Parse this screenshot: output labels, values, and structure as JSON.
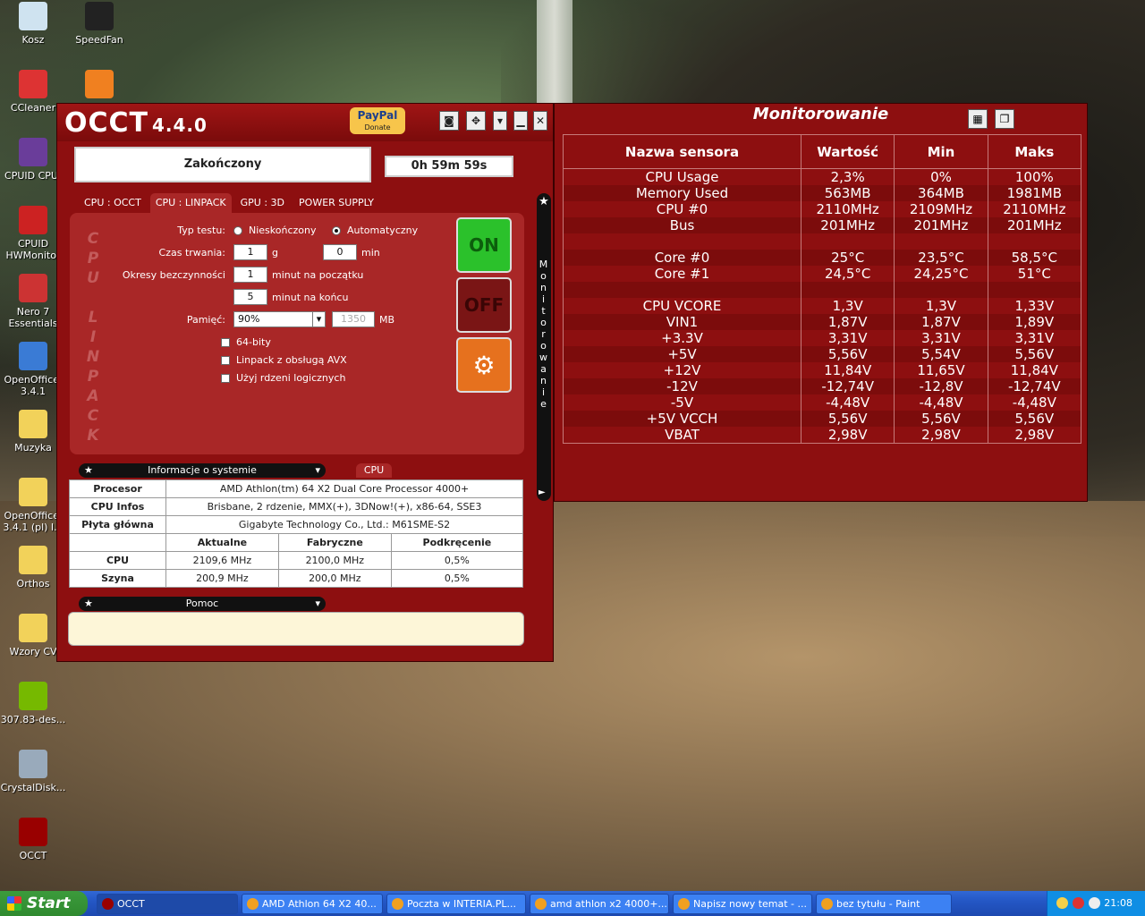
{
  "desktop": {
    "icons": [
      {
        "label": "Kosz",
        "icon": "recycle-bin-icon"
      },
      {
        "label": "SpeedFan",
        "icon": "fan-icon"
      },
      {
        "label": "CCleaner",
        "icon": "ccleaner-icon"
      },
      {
        "label": "",
        "icon": "avast-icon"
      },
      {
        "label": "CPUID CPU-",
        "icon": "cpuz-icon"
      },
      {
        "label": "CPUID HWMonitor",
        "icon": "hwmonitor-icon"
      },
      {
        "label": "Nero 7 Essentials",
        "icon": "nero-icon"
      },
      {
        "label": "OpenOffice. 3.4.1",
        "icon": "openoffice-icon"
      },
      {
        "label": "Muzyka",
        "icon": "folder-icon"
      },
      {
        "label": "OpenOffice. 3.4.1 (pl) I...",
        "icon": "folder-icon"
      },
      {
        "label": "Orthos",
        "icon": "folder-icon"
      },
      {
        "label": "Wzory CV",
        "icon": "folder-icon"
      },
      {
        "label": "307.83-des...",
        "icon": "nvidia-icon"
      },
      {
        "label": "CrystalDisk...",
        "icon": "crystaldisk-icon"
      },
      {
        "label": "OCCT",
        "icon": "occt-icon"
      }
    ]
  },
  "occt": {
    "logo": "OCCT",
    "version": "4.4.0",
    "paypal": {
      "label": "PayPal",
      "sub": "Donate"
    },
    "status": "Zakończony",
    "timer": "0h 59m 59s",
    "tabs": [
      "CPU : OCCT",
      "CPU : LINPACK",
      "GPU : 3D",
      "POWER SUPPLY"
    ],
    "active_tab": "CPU : LINPACK",
    "vertical_label": [
      "C",
      "P",
      "U",
      "",
      "L",
      "I",
      "N",
      "P",
      "A",
      "C",
      "K"
    ],
    "form": {
      "test_type_label": "Typ testu:",
      "radio_infinite": "Nieskończony",
      "radio_auto": "Automatyczny",
      "duration_label": "Czas trwania:",
      "duration_h": "1",
      "duration_h_unit": "g",
      "duration_min": "0",
      "duration_min_unit": "min",
      "idle_label": "Okresy bezczynności",
      "idle_start": "1",
      "idle_start_unit": "minut na początku",
      "idle_end": "5",
      "idle_end_unit": "minut na końcu",
      "memory_label": "Pamięć:",
      "memory_value": "90%",
      "memory_mb": "1350",
      "memory_unit": "MB",
      "chk_64bit": "64-bity",
      "chk_avx": "Linpack z obsługą AVX",
      "chk_logical": "Użyj rdzeni logicznych"
    },
    "buttons": {
      "on": "ON",
      "off": "OFF"
    },
    "side_label": "Monitorowanie",
    "sysinfo": {
      "header": "Informacje o systemie",
      "cpu_tab": "CPU",
      "rows": [
        {
          "label": "Procesor",
          "value": "AMD Athlon(tm) 64 X2 Dual Core Processor 4000+"
        },
        {
          "label": "CPU Infos",
          "value": "Brisbane, 2 rdzenie, MMX(+), 3DNow!(+), x86-64, SSE3"
        },
        {
          "label": "Płyta główna",
          "value": "Gigabyte Technology Co., Ltd.: M61SME-S2"
        }
      ],
      "freq_headers": [
        "",
        "Aktualne",
        "Fabryczne",
        "Podkręcenie"
      ],
      "freq_rows": [
        [
          "CPU",
          "2109,6 MHz",
          "2100,0 MHz",
          "0,5%"
        ],
        [
          "Szyna",
          "200,9 MHz",
          "200,0 MHz",
          "0,5%"
        ]
      ]
    },
    "help_header": "Pomoc"
  },
  "monitor": {
    "title": "Monitorowanie",
    "headers": [
      "Nazwa sensora",
      "Wartość",
      "Min",
      "Maks"
    ],
    "rows": [
      [
        "CPU Usage",
        "2,3%",
        "0%",
        "100%"
      ],
      [
        "Memory Used",
        "563MB",
        "364MB",
        "1981MB"
      ],
      [
        "CPU #0",
        "2110MHz",
        "2109MHz",
        "2110MHz"
      ],
      [
        "Bus",
        "201MHz",
        "201MHz",
        "201MHz"
      ],
      [
        "",
        "",
        "",
        ""
      ],
      [
        "Core #0",
        "25°C",
        "23,5°C",
        "58,5°C"
      ],
      [
        "Core #1",
        "24,5°C",
        "24,25°C",
        "51°C"
      ],
      [
        "",
        "",
        "",
        ""
      ],
      [
        "CPU VCORE",
        "1,3V",
        "1,3V",
        "1,33V"
      ],
      [
        "VIN1",
        "1,87V",
        "1,87V",
        "1,89V"
      ],
      [
        "+3.3V",
        "3,31V",
        "3,31V",
        "3,31V"
      ],
      [
        "+5V",
        "5,56V",
        "5,54V",
        "5,56V"
      ],
      [
        "+12V",
        "11,84V",
        "11,65V",
        "11,84V"
      ],
      [
        "-12V",
        "-12,74V",
        "-12,8V",
        "-12,74V"
      ],
      [
        "-5V",
        "-4,48V",
        "-4,48V",
        "-4,48V"
      ],
      [
        "+5V VCCH",
        "5,56V",
        "5,56V",
        "5,56V"
      ],
      [
        "VBAT",
        "2,98V",
        "2,98V",
        "2,98V"
      ]
    ]
  },
  "taskbar": {
    "start": "Start",
    "tasks": [
      {
        "label": "OCCT",
        "active": true
      },
      {
        "label": "AMD Athlon 64 X2 40..."
      },
      {
        "label": "Poczta w INTERIA.PL..."
      },
      {
        "label": "amd athlon x2 4000+..."
      },
      {
        "label": "Napisz nowy temat - ..."
      },
      {
        "label": "bez tytułu - Paint"
      }
    ],
    "clock": "21:08"
  },
  "colors": {
    "occt_red": "#8d0f10",
    "panel_red": "#a92727",
    "taskbar_blue": "#2457c5",
    "on_green": "#2bc12b",
    "off_red": "#7a1515"
  }
}
